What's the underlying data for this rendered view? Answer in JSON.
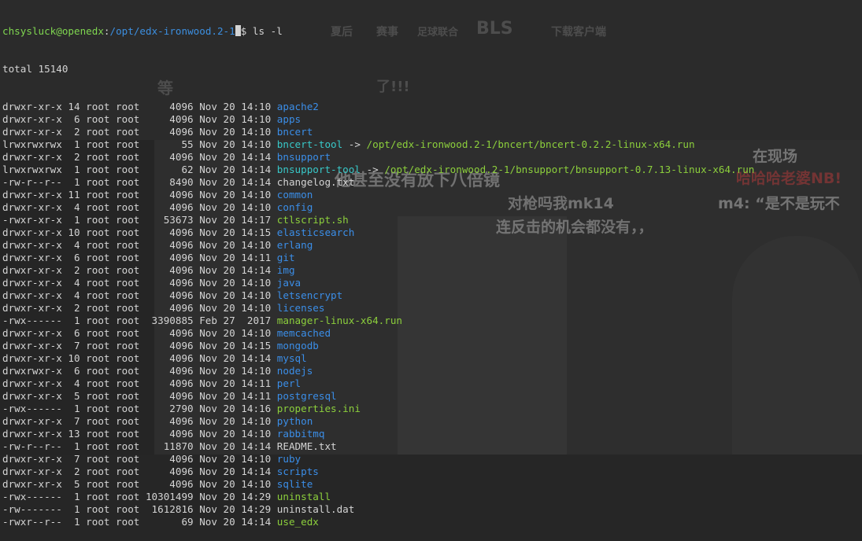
{
  "prompt": {
    "user_host": "chsysluck@openedx",
    "separator": ":",
    "path": "/opt/edx-ironwood.2-1",
    "symbol": "$",
    "command": "ls -l"
  },
  "total_line": "total 15140",
  "colors": {
    "directory": "#3b8ee8",
    "executable": "#8ccf3c",
    "symlink": "#38c8c8",
    "regular": "#d4d4d4",
    "prompt_user": "#7fd650",
    "prompt_path": "#3c8fe0",
    "background": "#262626"
  },
  "entries": [
    {
      "perm": "drwxr-xr-x",
      "links": "14",
      "owner": "root",
      "group": "root",
      "size": "4096",
      "month": "Nov",
      "day": "20",
      "time": "14:10",
      "name": "apache2",
      "kind": "dir"
    },
    {
      "perm": "drwxr-xr-x",
      "links": "6",
      "owner": "root",
      "group": "root",
      "size": "4096",
      "month": "Nov",
      "day": "20",
      "time": "14:10",
      "name": "apps",
      "kind": "dir"
    },
    {
      "perm": "drwxr-xr-x",
      "links": "2",
      "owner": "root",
      "group": "root",
      "size": "4096",
      "month": "Nov",
      "day": "20",
      "time": "14:10",
      "name": "bncert",
      "kind": "dir"
    },
    {
      "perm": "lrwxrwxrwx",
      "links": "1",
      "owner": "root",
      "group": "root",
      "size": "55",
      "month": "Nov",
      "day": "20",
      "time": "14:10",
      "name": "bncert-tool",
      "kind": "link",
      "target": "/opt/edx-ironwood.2-1/bncert/bncert-0.2.2-linux-x64.run"
    },
    {
      "perm": "drwxr-xr-x",
      "links": "2",
      "owner": "root",
      "group": "root",
      "size": "4096",
      "month": "Nov",
      "day": "20",
      "time": "14:14",
      "name": "bnsupport",
      "kind": "dir"
    },
    {
      "perm": "lrwxrwxrwx",
      "links": "1",
      "owner": "root",
      "group": "root",
      "size": "62",
      "month": "Nov",
      "day": "20",
      "time": "14:14",
      "name": "bnsupport-tool",
      "kind": "link",
      "target": "/opt/edx-ironwood.2-1/bnsupport/bnsupport-0.7.13-linux-x64.run"
    },
    {
      "perm": "-rw-r--r--",
      "links": "1",
      "owner": "root",
      "group": "root",
      "size": "8490",
      "month": "Nov",
      "day": "20",
      "time": "14:14",
      "name": "changelog.txt",
      "kind": "file"
    },
    {
      "perm": "drwxr-xr-x",
      "links": "11",
      "owner": "root",
      "group": "root",
      "size": "4096",
      "month": "Nov",
      "day": "20",
      "time": "14:10",
      "name": "common",
      "kind": "dir"
    },
    {
      "perm": "drwxr-xr-x",
      "links": "4",
      "owner": "root",
      "group": "root",
      "size": "4096",
      "month": "Nov",
      "day": "20",
      "time": "14:10",
      "name": "config",
      "kind": "dir"
    },
    {
      "perm": "-rwxr-xr-x",
      "links": "1",
      "owner": "root",
      "group": "root",
      "size": "53673",
      "month": "Nov",
      "day": "20",
      "time": "14:17",
      "name": "ctlscript.sh",
      "kind": "exec"
    },
    {
      "perm": "drwxr-xr-x",
      "links": "10",
      "owner": "root",
      "group": "root",
      "size": "4096",
      "month": "Nov",
      "day": "20",
      "time": "14:15",
      "name": "elasticsearch",
      "kind": "dir"
    },
    {
      "perm": "drwxr-xr-x",
      "links": "4",
      "owner": "root",
      "group": "root",
      "size": "4096",
      "month": "Nov",
      "day": "20",
      "time": "14:10",
      "name": "erlang",
      "kind": "dir"
    },
    {
      "perm": "drwxr-xr-x",
      "links": "6",
      "owner": "root",
      "group": "root",
      "size": "4096",
      "month": "Nov",
      "day": "20",
      "time": "14:11",
      "name": "git",
      "kind": "dir"
    },
    {
      "perm": "drwxr-xr-x",
      "links": "2",
      "owner": "root",
      "group": "root",
      "size": "4096",
      "month": "Nov",
      "day": "20",
      "time": "14:14",
      "name": "img",
      "kind": "dir"
    },
    {
      "perm": "drwxr-xr-x",
      "links": "4",
      "owner": "root",
      "group": "root",
      "size": "4096",
      "month": "Nov",
      "day": "20",
      "time": "14:10",
      "name": "java",
      "kind": "dir"
    },
    {
      "perm": "drwxr-xr-x",
      "links": "4",
      "owner": "root",
      "group": "root",
      "size": "4096",
      "month": "Nov",
      "day": "20",
      "time": "14:10",
      "name": "letsencrypt",
      "kind": "dir"
    },
    {
      "perm": "drwxr-xr-x",
      "links": "2",
      "owner": "root",
      "group": "root",
      "size": "4096",
      "month": "Nov",
      "day": "20",
      "time": "14:10",
      "name": "licenses",
      "kind": "dir"
    },
    {
      "perm": "-rwx------",
      "links": "1",
      "owner": "root",
      "group": "root",
      "size": "3390885",
      "month": "Feb",
      "day": "27",
      "time": " 2017",
      "name": "manager-linux-x64.run",
      "kind": "exec"
    },
    {
      "perm": "drwxr-xr-x",
      "links": "6",
      "owner": "root",
      "group": "root",
      "size": "4096",
      "month": "Nov",
      "day": "20",
      "time": "14:10",
      "name": "memcached",
      "kind": "dir"
    },
    {
      "perm": "drwxr-xr-x",
      "links": "7",
      "owner": "root",
      "group": "root",
      "size": "4096",
      "month": "Nov",
      "day": "20",
      "time": "14:15",
      "name": "mongodb",
      "kind": "dir"
    },
    {
      "perm": "drwxr-xr-x",
      "links": "10",
      "owner": "root",
      "group": "root",
      "size": "4096",
      "month": "Nov",
      "day": "20",
      "time": "14:14",
      "name": "mysql",
      "kind": "dir"
    },
    {
      "perm": "drwxrwxr-x",
      "links": "6",
      "owner": "root",
      "group": "root",
      "size": "4096",
      "month": "Nov",
      "day": "20",
      "time": "14:10",
      "name": "nodejs",
      "kind": "dir"
    },
    {
      "perm": "drwxr-xr-x",
      "links": "4",
      "owner": "root",
      "group": "root",
      "size": "4096",
      "month": "Nov",
      "day": "20",
      "time": "14:11",
      "name": "perl",
      "kind": "dir"
    },
    {
      "perm": "drwxr-xr-x",
      "links": "5",
      "owner": "root",
      "group": "root",
      "size": "4096",
      "month": "Nov",
      "day": "20",
      "time": "14:11",
      "name": "postgresql",
      "kind": "dir"
    },
    {
      "perm": "-rwx------",
      "links": "1",
      "owner": "root",
      "group": "root",
      "size": "2790",
      "month": "Nov",
      "day": "20",
      "time": "14:16",
      "name": "properties.ini",
      "kind": "exec"
    },
    {
      "perm": "drwxr-xr-x",
      "links": "7",
      "owner": "root",
      "group": "root",
      "size": "4096",
      "month": "Nov",
      "day": "20",
      "time": "14:10",
      "name": "python",
      "kind": "dir"
    },
    {
      "perm": "drwxr-xr-x",
      "links": "13",
      "owner": "root",
      "group": "root",
      "size": "4096",
      "month": "Nov",
      "day": "20",
      "time": "14:10",
      "name": "rabbitmq",
      "kind": "dir"
    },
    {
      "perm": "-rw-r--r--",
      "links": "1",
      "owner": "root",
      "group": "root",
      "size": "11870",
      "month": "Nov",
      "day": "20",
      "time": "14:14",
      "name": "README.txt",
      "kind": "file"
    },
    {
      "perm": "drwxr-xr-x",
      "links": "7",
      "owner": "root",
      "group": "root",
      "size": "4096",
      "month": "Nov",
      "day": "20",
      "time": "14:10",
      "name": "ruby",
      "kind": "dir"
    },
    {
      "perm": "drwxr-xr-x",
      "links": "2",
      "owner": "root",
      "group": "root",
      "size": "4096",
      "month": "Nov",
      "day": "20",
      "time": "14:14",
      "name": "scripts",
      "kind": "dir"
    },
    {
      "perm": "drwxr-xr-x",
      "links": "5",
      "owner": "root",
      "group": "root",
      "size": "4096",
      "month": "Nov",
      "day": "20",
      "time": "14:10",
      "name": "sqlite",
      "kind": "dir"
    },
    {
      "perm": "-rwx------",
      "links": "1",
      "owner": "root",
      "group": "root",
      "size": "10301499",
      "month": "Nov",
      "day": "20",
      "time": "14:29",
      "name": "uninstall",
      "kind": "exec"
    },
    {
      "perm": "-rw-------",
      "links": "1",
      "owner": "root",
      "group": "root",
      "size": "1612816",
      "month": "Nov",
      "day": "20",
      "time": "14:29",
      "name": "uninstall.dat",
      "kind": "file"
    },
    {
      "perm": "-rwxr--r--",
      "links": "1",
      "owner": "root",
      "group": "root",
      "size": "69",
      "month": "Nov",
      "day": "20",
      "time": "14:14",
      "name": "use_edx",
      "kind": "exec"
    }
  ],
  "background_overlay": {
    "top_texts": [
      "等",
      "了!!!",
      "赛事",
      "足球联合",
      "下载客户端",
      "夏后"
    ],
    "overlay_texts": [
      "在现场",
      "哈哈哈老婆NB!",
      "m4: “是不是玩不",
      "他甚至没有放下八倍镜",
      "对枪吗我mk14",
      "连反击的机会都没有，，"
    ],
    "logo_text": "BLS"
  }
}
